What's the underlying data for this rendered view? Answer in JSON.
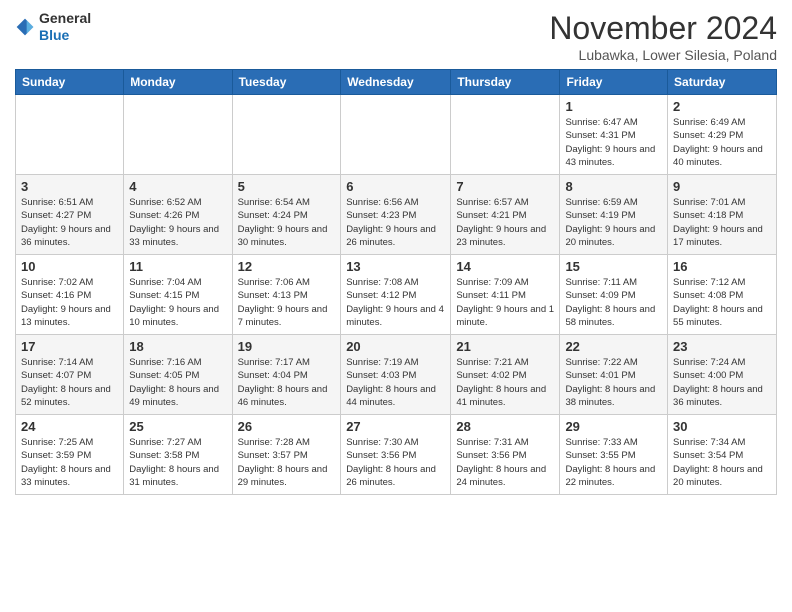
{
  "header": {
    "logo_line1": "General",
    "logo_line2": "Blue",
    "month": "November 2024",
    "location": "Lubawka, Lower Silesia, Poland"
  },
  "weekdays": [
    "Sunday",
    "Monday",
    "Tuesday",
    "Wednesday",
    "Thursday",
    "Friday",
    "Saturday"
  ],
  "weeks": [
    [
      {
        "day": "",
        "info": ""
      },
      {
        "day": "",
        "info": ""
      },
      {
        "day": "",
        "info": ""
      },
      {
        "day": "",
        "info": ""
      },
      {
        "day": "",
        "info": ""
      },
      {
        "day": "1",
        "info": "Sunrise: 6:47 AM\nSunset: 4:31 PM\nDaylight: 9 hours\nand 43 minutes."
      },
      {
        "day": "2",
        "info": "Sunrise: 6:49 AM\nSunset: 4:29 PM\nDaylight: 9 hours\nand 40 minutes."
      }
    ],
    [
      {
        "day": "3",
        "info": "Sunrise: 6:51 AM\nSunset: 4:27 PM\nDaylight: 9 hours\nand 36 minutes."
      },
      {
        "day": "4",
        "info": "Sunrise: 6:52 AM\nSunset: 4:26 PM\nDaylight: 9 hours\nand 33 minutes."
      },
      {
        "day": "5",
        "info": "Sunrise: 6:54 AM\nSunset: 4:24 PM\nDaylight: 9 hours\nand 30 minutes."
      },
      {
        "day": "6",
        "info": "Sunrise: 6:56 AM\nSunset: 4:23 PM\nDaylight: 9 hours\nand 26 minutes."
      },
      {
        "day": "7",
        "info": "Sunrise: 6:57 AM\nSunset: 4:21 PM\nDaylight: 9 hours\nand 23 minutes."
      },
      {
        "day": "8",
        "info": "Sunrise: 6:59 AM\nSunset: 4:19 PM\nDaylight: 9 hours\nand 20 minutes."
      },
      {
        "day": "9",
        "info": "Sunrise: 7:01 AM\nSunset: 4:18 PM\nDaylight: 9 hours\nand 17 minutes."
      }
    ],
    [
      {
        "day": "10",
        "info": "Sunrise: 7:02 AM\nSunset: 4:16 PM\nDaylight: 9 hours\nand 13 minutes."
      },
      {
        "day": "11",
        "info": "Sunrise: 7:04 AM\nSunset: 4:15 PM\nDaylight: 9 hours\nand 10 minutes."
      },
      {
        "day": "12",
        "info": "Sunrise: 7:06 AM\nSunset: 4:13 PM\nDaylight: 9 hours\nand 7 minutes."
      },
      {
        "day": "13",
        "info": "Sunrise: 7:08 AM\nSunset: 4:12 PM\nDaylight: 9 hours\nand 4 minutes."
      },
      {
        "day": "14",
        "info": "Sunrise: 7:09 AM\nSunset: 4:11 PM\nDaylight: 9 hours\nand 1 minute."
      },
      {
        "day": "15",
        "info": "Sunrise: 7:11 AM\nSunset: 4:09 PM\nDaylight: 8 hours\nand 58 minutes."
      },
      {
        "day": "16",
        "info": "Sunrise: 7:12 AM\nSunset: 4:08 PM\nDaylight: 8 hours\nand 55 minutes."
      }
    ],
    [
      {
        "day": "17",
        "info": "Sunrise: 7:14 AM\nSunset: 4:07 PM\nDaylight: 8 hours\nand 52 minutes."
      },
      {
        "day": "18",
        "info": "Sunrise: 7:16 AM\nSunset: 4:05 PM\nDaylight: 8 hours\nand 49 minutes."
      },
      {
        "day": "19",
        "info": "Sunrise: 7:17 AM\nSunset: 4:04 PM\nDaylight: 8 hours\nand 46 minutes."
      },
      {
        "day": "20",
        "info": "Sunrise: 7:19 AM\nSunset: 4:03 PM\nDaylight: 8 hours\nand 44 minutes."
      },
      {
        "day": "21",
        "info": "Sunrise: 7:21 AM\nSunset: 4:02 PM\nDaylight: 8 hours\nand 41 minutes."
      },
      {
        "day": "22",
        "info": "Sunrise: 7:22 AM\nSunset: 4:01 PM\nDaylight: 8 hours\nand 38 minutes."
      },
      {
        "day": "23",
        "info": "Sunrise: 7:24 AM\nSunset: 4:00 PM\nDaylight: 8 hours\nand 36 minutes."
      }
    ],
    [
      {
        "day": "24",
        "info": "Sunrise: 7:25 AM\nSunset: 3:59 PM\nDaylight: 8 hours\nand 33 minutes."
      },
      {
        "day": "25",
        "info": "Sunrise: 7:27 AM\nSunset: 3:58 PM\nDaylight: 8 hours\nand 31 minutes."
      },
      {
        "day": "26",
        "info": "Sunrise: 7:28 AM\nSunset: 3:57 PM\nDaylight: 8 hours\nand 29 minutes."
      },
      {
        "day": "27",
        "info": "Sunrise: 7:30 AM\nSunset: 3:56 PM\nDaylight: 8 hours\nand 26 minutes."
      },
      {
        "day": "28",
        "info": "Sunrise: 7:31 AM\nSunset: 3:56 PM\nDaylight: 8 hours\nand 24 minutes."
      },
      {
        "day": "29",
        "info": "Sunrise: 7:33 AM\nSunset: 3:55 PM\nDaylight: 8 hours\nand 22 minutes."
      },
      {
        "day": "30",
        "info": "Sunrise: 7:34 AM\nSunset: 3:54 PM\nDaylight: 8 hours\nand 20 minutes."
      }
    ]
  ]
}
